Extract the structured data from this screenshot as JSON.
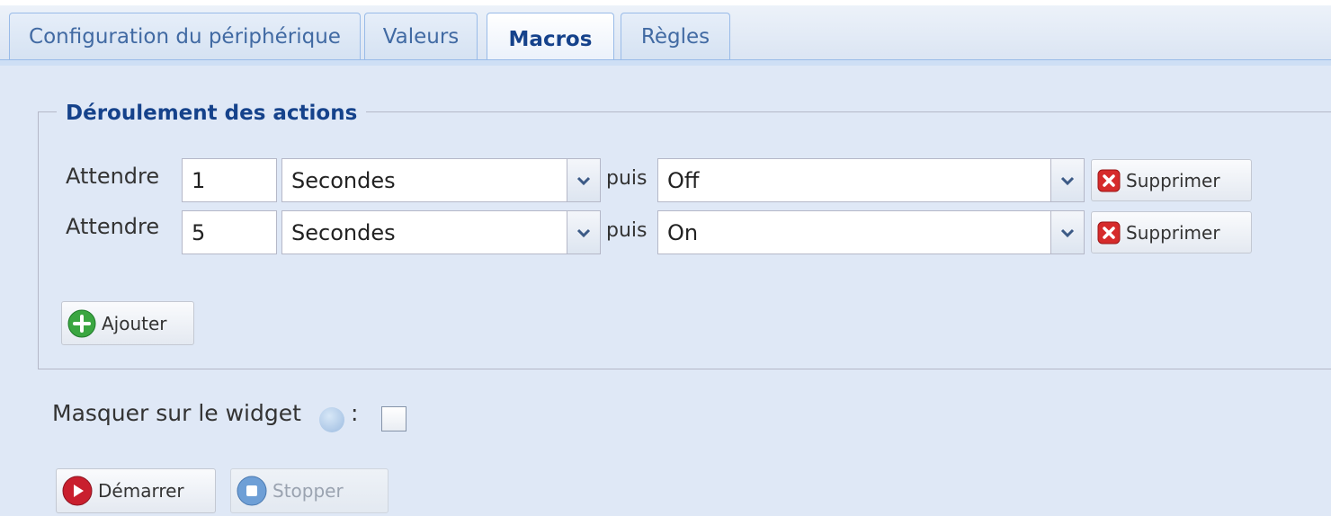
{
  "tabs": [
    {
      "label": "Configuration du périphérique",
      "active": false
    },
    {
      "label": "Valeurs",
      "active": false
    },
    {
      "label": "Macros",
      "active": true
    },
    {
      "label": "Règles",
      "active": false
    }
  ],
  "actions_section": {
    "title": "Déroulement des actions",
    "rows": [
      {
        "wait_label": "Attendre",
        "duration": "1",
        "unit": "Secondes",
        "then_label": "puis",
        "action": "Off",
        "delete_label": "Supprimer"
      },
      {
        "wait_label": "Attendre",
        "duration": "5",
        "unit": "Secondes",
        "then_label": "puis",
        "action": "On",
        "delete_label": "Supprimer"
      }
    ],
    "add_label": "Ajouter"
  },
  "hide_widget": {
    "label": "Masquer sur le widget",
    "colon": ":",
    "checked": false
  },
  "buttons": {
    "start_label": "Démarrer",
    "stop_label": "Stopper"
  },
  "colors": {
    "accent": "#15428b",
    "tab_border": "#99bbe8",
    "panel_bg": "#dfe8f6",
    "delete_red": "#d62b2b",
    "add_green": "#3aa641"
  }
}
